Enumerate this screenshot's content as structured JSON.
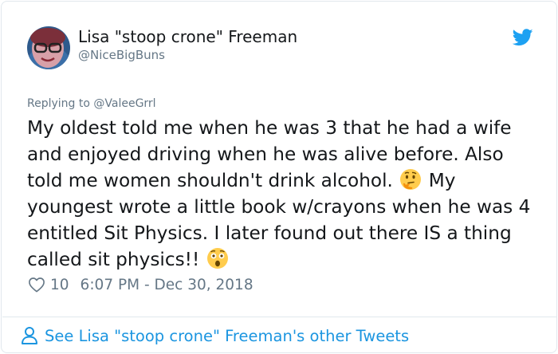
{
  "tweet": {
    "author_name": "Lisa \"stoop crone\" Freeman",
    "author_handle": "@NiceBigBuns",
    "replying_to_label": "Replying to @ValeeGrrl",
    "text_parts": [
      "My oldest told me when he was 3 that he had a wife and enjoyed driving when he was alive before. Also told me women shouldn't drink alcohol.",
      " My youngest wrote a little book w/crayons when he was 4 entitled Sit Physics. I later found out there IS a thing called sit physics!!"
    ],
    "emojis": [
      "thinking-face",
      "astonished-face"
    ],
    "like_count": "10",
    "timestamp": "6:07 PM - Dec 30, 2018",
    "footer_link": "See Lisa \"stoop crone\" Freeman's other Tweets"
  },
  "icons": {
    "platform": "twitter-bird-icon",
    "like": "heart-outline-icon",
    "profile": "person-outline-icon"
  },
  "colors": {
    "brand_blue": "#1da1f2",
    "link_blue": "#1b95e0",
    "secondary_text": "#657786",
    "primary_text": "#14171a",
    "border": "#e1e8ed"
  }
}
